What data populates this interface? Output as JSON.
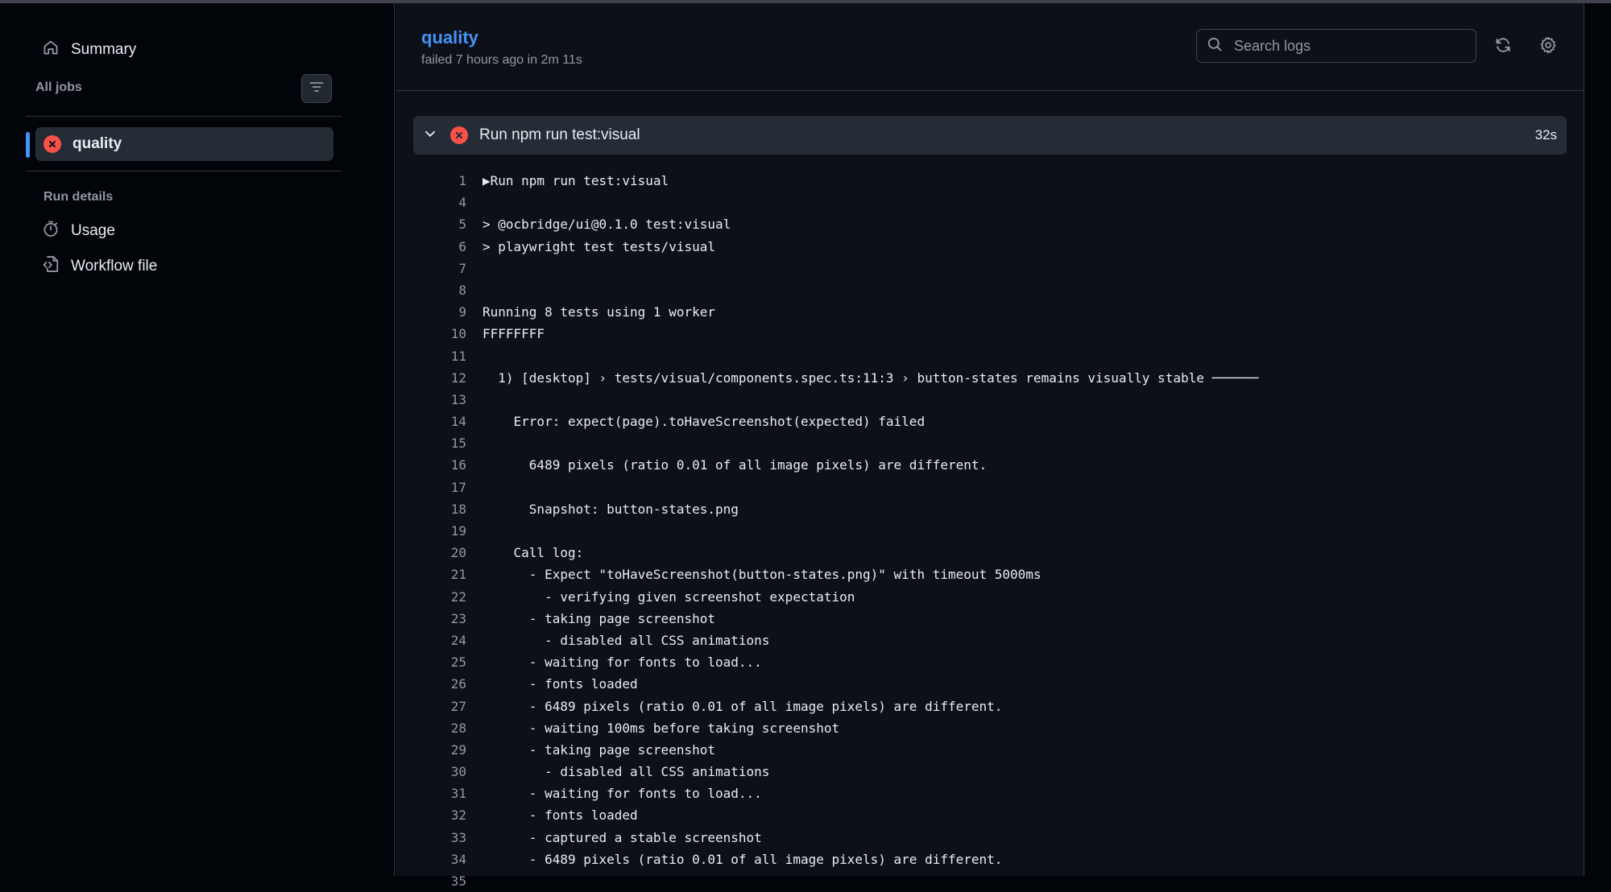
{
  "sidebar": {
    "summary_label": "Summary",
    "all_jobs_label": "All jobs",
    "jobs": [
      {
        "label": "quality",
        "status": "failed"
      }
    ],
    "run_details_label": "Run details",
    "usage_label": "Usage",
    "workflow_file_label": "Workflow file"
  },
  "header": {
    "title": "quality",
    "status_text": "failed 7 hours ago in 2m 11s",
    "search_placeholder": "Search logs"
  },
  "step": {
    "title": "Run npm run test:visual",
    "duration": "32s"
  },
  "colors": {
    "accent": "#4493f8",
    "failure": "#f85149",
    "muted": "#9198a1"
  },
  "icons": [
    "house-icon",
    "filter-icon",
    "x-circle-fill-icon",
    "stopwatch-icon",
    "file-code-icon",
    "search-icon",
    "sync-icon",
    "gear-icon",
    "chevron-down-icon"
  ],
  "log_lines": [
    {
      "n": "1",
      "t": "▶Run npm run test:visual"
    },
    {
      "n": "4",
      "t": ""
    },
    {
      "n": "5",
      "t": "> @ocbridge/ui@0.1.0 test:visual"
    },
    {
      "n": "6",
      "t": "> playwright test tests/visual"
    },
    {
      "n": "7",
      "t": ""
    },
    {
      "n": "8",
      "t": ""
    },
    {
      "n": "9",
      "t": "Running 8 tests using 1 worker"
    },
    {
      "n": "10",
      "t": "FFFFFFFF"
    },
    {
      "n": "11",
      "t": ""
    },
    {
      "n": "12",
      "t": "  1) [desktop] › tests/visual/components.spec.ts:11:3 › button-states remains visually stable ──────"
    },
    {
      "n": "13",
      "t": ""
    },
    {
      "n": "14",
      "t": "    Error: expect(page).toHaveScreenshot(expected) failed"
    },
    {
      "n": "15",
      "t": ""
    },
    {
      "n": "16",
      "t": "      6489 pixels (ratio 0.01 of all image pixels) are different."
    },
    {
      "n": "17",
      "t": ""
    },
    {
      "n": "18",
      "t": "      Snapshot: button-states.png"
    },
    {
      "n": "19",
      "t": ""
    },
    {
      "n": "20",
      "t": "    Call log:"
    },
    {
      "n": "21",
      "t": "      - Expect \"toHaveScreenshot(button-states.png)\" with timeout 5000ms"
    },
    {
      "n": "22",
      "t": "        - verifying given screenshot expectation"
    },
    {
      "n": "23",
      "t": "      - taking page screenshot"
    },
    {
      "n": "24",
      "t": "        - disabled all CSS animations"
    },
    {
      "n": "25",
      "t": "      - waiting for fonts to load..."
    },
    {
      "n": "26",
      "t": "      - fonts loaded"
    },
    {
      "n": "27",
      "t": "      - 6489 pixels (ratio 0.01 of all image pixels) are different."
    },
    {
      "n": "28",
      "t": "      - waiting 100ms before taking screenshot"
    },
    {
      "n": "29",
      "t": "      - taking page screenshot"
    },
    {
      "n": "30",
      "t": "        - disabled all CSS animations"
    },
    {
      "n": "31",
      "t": "      - waiting for fonts to load..."
    },
    {
      "n": "32",
      "t": "      - fonts loaded"
    },
    {
      "n": "33",
      "t": "      - captured a stable screenshot"
    },
    {
      "n": "34",
      "t": "      - 6489 pixels (ratio 0.01 of all image pixels) are different."
    },
    {
      "n": "35",
      "t": ""
    }
  ]
}
